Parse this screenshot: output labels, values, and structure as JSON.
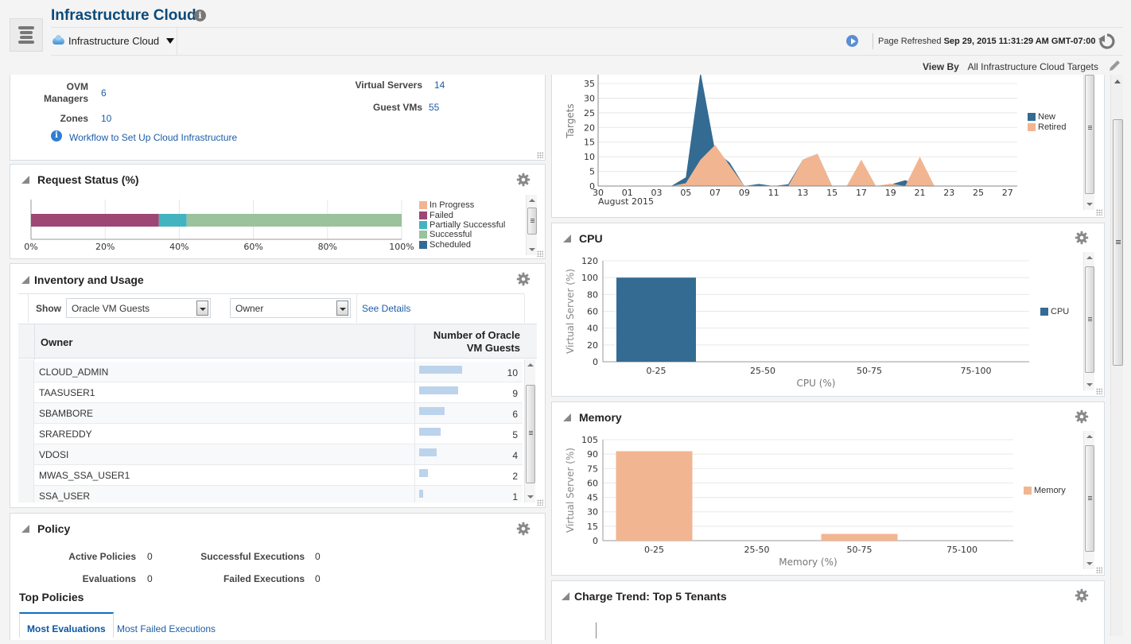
{
  "header": {
    "title": "Infrastructure Cloud",
    "target_menu": "Infrastructure Cloud",
    "refresh_label": "Page Refreshed",
    "refresh_time": "Sep 29, 2015 11:31:29 AM GMT-07:00",
    "view_by_label": "View By",
    "view_by_value": "All Infrastructure Cloud Targets"
  },
  "summary": {
    "items": [
      {
        "label": "OVM Managers",
        "value": "6"
      },
      {
        "label": "Zones",
        "value": "10"
      },
      {
        "label": "Virtual Servers",
        "value": "14"
      },
      {
        "label": "Guest VMs",
        "value": "55"
      }
    ],
    "workflow_link": "Workflow to Set Up Cloud Infrastructure"
  },
  "request_status": {
    "title": "Request Status (%)",
    "chart_data": {
      "type": "bar",
      "orientation": "horizontal-stacked",
      "xlim": [
        0,
        100
      ],
      "ticks": [
        "0%",
        "20%",
        "40%",
        "60%",
        "80%",
        "100%"
      ],
      "series": [
        {
          "name": "In Progress",
          "value": 0,
          "color": "#f2b591"
        },
        {
          "name": "Failed",
          "value": 34.5,
          "color": "#9e4674"
        },
        {
          "name": "Partially Successful",
          "value": 7.5,
          "color": "#43b4bf"
        },
        {
          "name": "Successful",
          "value": 58,
          "color": "#9bc29c"
        },
        {
          "name": "Scheduled",
          "value": 0,
          "color": "#336b93"
        }
      ],
      "legend_position": "right"
    }
  },
  "inventory": {
    "title": "Inventory and Usage",
    "show_label": "Show",
    "select1": "Oracle VM Guests",
    "select2": "Owner",
    "see_details": "See Details",
    "columns": [
      "Owner",
      "Number of Oracle VM Guests"
    ],
    "rows": [
      {
        "owner": "CLOUD_ADMIN",
        "count": 10
      },
      {
        "owner": "TAASUSER1",
        "count": 9
      },
      {
        "owner": "SBAMBORE",
        "count": 6
      },
      {
        "owner": "SRAREDDY",
        "count": 5
      },
      {
        "owner": "VDOSI",
        "count": 4
      },
      {
        "owner": "MWAS_SSA_USER1",
        "count": 2
      },
      {
        "owner": "SSA_USER",
        "count": 1
      }
    ],
    "bar_max": 10
  },
  "policy": {
    "title": "Policy",
    "stats": [
      {
        "label": "Active Policies",
        "value": "0"
      },
      {
        "label": "Evaluations",
        "value": "0"
      },
      {
        "label": "Successful Executions",
        "value": "0"
      },
      {
        "label": "Failed Executions",
        "value": "0"
      }
    ],
    "top_policies_title": "Top Policies",
    "tabs": [
      "Most Evaluations",
      "Most Failed Executions"
    ],
    "active_tab": 0
  },
  "targets_trend": {
    "chart_data": {
      "type": "area",
      "ylabel": "Targets",
      "xlabel": "August 2015",
      "ylim": [
        0,
        38
      ],
      "yticks": [
        0,
        5,
        10,
        15,
        20,
        25,
        30,
        35
      ],
      "xtick_labels": [
        "30",
        "01",
        "03",
        "05",
        "07",
        "09",
        "11",
        "13",
        "15",
        "17",
        "19",
        "21",
        "23",
        "25",
        "27"
      ],
      "x_days": [
        -1,
        0,
        1,
        2,
        3,
        4,
        5,
        6,
        7,
        8,
        9,
        10,
        11,
        12,
        13,
        14,
        15,
        16,
        17,
        18,
        19,
        20,
        21,
        22,
        23,
        24,
        25,
        26,
        27,
        28
      ],
      "series": [
        {
          "name": "New",
          "color": "#336b93",
          "values": [
            0,
            0,
            0,
            0,
            0,
            0,
            3,
            39,
            12,
            8,
            0,
            0.7,
            0,
            0.6,
            9,
            11,
            0,
            0,
            0,
            0,
            0.5,
            2,
            0,
            0,
            0,
            0,
            0,
            0,
            0,
            0
          ]
        },
        {
          "name": "Retired",
          "color": "#f2b591",
          "values": [
            0,
            0,
            0,
            0,
            0,
            0,
            1,
            9,
            14,
            7,
            0,
            0,
            0,
            0,
            9,
            11,
            0,
            0,
            9,
            0,
            0.8,
            0,
            10,
            0,
            0,
            0,
            0,
            0,
            0,
            0
          ]
        }
      ],
      "legend_position": "right"
    }
  },
  "cpu": {
    "title": "CPU",
    "chart_data": {
      "type": "bar",
      "categories": [
        "0-25",
        "25-50",
        "50-75",
        "75-100"
      ],
      "series": [
        {
          "name": "CPU",
          "values": [
            100,
            0,
            0,
            0
          ],
          "color": "#336b93"
        }
      ],
      "xlabel": "CPU (%)",
      "ylabel": "Virtual Server (%)",
      "ylim": [
        0,
        120
      ],
      "yticks": [
        0,
        20,
        40,
        60,
        80,
        100,
        120
      ],
      "legend_position": "right"
    }
  },
  "memory": {
    "title": "Memory",
    "chart_data": {
      "type": "bar",
      "categories": [
        "0-25",
        "25-50",
        "50-75",
        "75-100"
      ],
      "series": [
        {
          "name": "Memory",
          "values": [
            93,
            0,
            7,
            0
          ],
          "color": "#f2b591"
        }
      ],
      "xlabel": "Memory (%)",
      "ylabel": "Virtual Server (%)",
      "ylim": [
        0,
        105
      ],
      "yticks": [
        0,
        15,
        30,
        45,
        60,
        75,
        90,
        105
      ],
      "legend_position": "right"
    }
  },
  "charge_trend": {
    "title": "Charge Trend: Top 5 Tenants"
  }
}
